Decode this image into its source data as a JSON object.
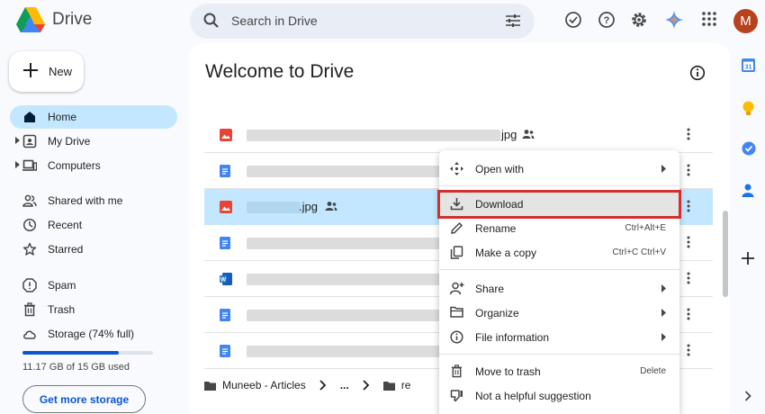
{
  "app": {
    "name": "Drive"
  },
  "search": {
    "placeholder": "Search in Drive"
  },
  "user": {
    "avatar_initial": "M",
    "avatar_color": "#b6431d"
  },
  "new_button": {
    "label": "New"
  },
  "sidebar": {
    "items": [
      {
        "label": "Home",
        "icon": "home-icon",
        "active": true
      },
      {
        "label": "My Drive",
        "icon": "my-drive-icon"
      },
      {
        "label": "Computers",
        "icon": "computers-icon"
      },
      {
        "label": "Shared with me",
        "icon": "shared-icon"
      },
      {
        "label": "Recent",
        "icon": "clock-icon"
      },
      {
        "label": "Starred",
        "icon": "star-icon"
      },
      {
        "label": "Spam",
        "icon": "spam-icon"
      },
      {
        "label": "Trash",
        "icon": "trash-icon"
      },
      {
        "label": "Storage (74% full)",
        "icon": "cloud-icon"
      }
    ]
  },
  "storage": {
    "used_text": "11.17 GB of 15 GB used",
    "fraction_used": 0.74,
    "button_label": "Get more storage"
  },
  "main": {
    "title": "Welcome to Drive",
    "files": [
      {
        "type": "image",
        "name_suffix": "jpg",
        "shared": true
      },
      {
        "type": "doc",
        "name_suffix": "",
        "shared": false
      },
      {
        "type": "image",
        "name_suffix": ".jpg",
        "shared": true,
        "selected": true
      },
      {
        "type": "doc",
        "name_suffix": "",
        "shared": false
      },
      {
        "type": "word",
        "name_suffix": "",
        "shared": false
      },
      {
        "type": "doc",
        "name_suffix": "",
        "shared": false
      },
      {
        "type": "doc",
        "name_suffix": "",
        "shared": false
      }
    ],
    "breadcrumb": {
      "folder": "Muneeb - Articles",
      "ellipsis": "...",
      "next_partial": "re"
    }
  },
  "context_menu": {
    "items": [
      {
        "label": "Open with",
        "icon": "open-with-icon",
        "submenu": true
      },
      {
        "label": "Download",
        "icon": "download-icon",
        "highlighted": true
      },
      {
        "label": "Rename",
        "icon": "rename-icon",
        "shortcut": "Ctrl+Alt+E"
      },
      {
        "label": "Make a copy",
        "icon": "copy-icon",
        "shortcut": "Ctrl+C Ctrl+V"
      },
      {
        "label": "Share",
        "icon": "share-icon",
        "submenu": true
      },
      {
        "label": "Organize",
        "icon": "folder-icon",
        "submenu": true
      },
      {
        "label": "File information",
        "icon": "info-icon",
        "submenu": true
      },
      {
        "label": "Move to trash",
        "icon": "trash-icon",
        "shortcut": "Delete"
      },
      {
        "label": "Not a helpful suggestion",
        "icon": "feedback-icon"
      }
    ]
  },
  "colors": {
    "accent": "#0b57d0",
    "active_nav": "#c2e7ff",
    "highlight_border": "#d32f2f"
  }
}
